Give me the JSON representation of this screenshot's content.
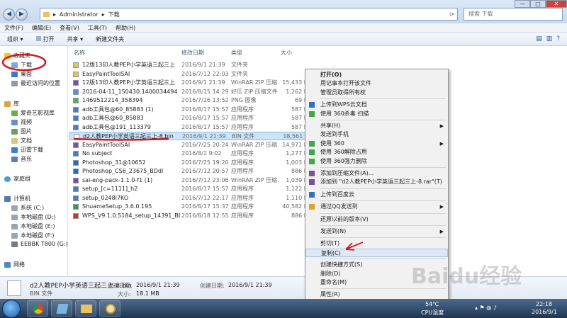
{
  "window": {
    "breadcrumb": [
      "Administrator",
      "下载"
    ],
    "search_placeholder": "搜索 下载",
    "controls": [
      "—",
      "□",
      "✕"
    ]
  },
  "menubar": [
    "文件(F)",
    "编辑(E)",
    "查看(V)",
    "工具(T)",
    "帮助(H)"
  ],
  "toolbar": {
    "organize": "组织 ▾",
    "open": "打开",
    "share": "共享 ▾",
    "new_folder": "新建文件夹"
  },
  "nav": {
    "favorites": "收藏夹",
    "downloads": "下载",
    "desktop": "桌面",
    "recent": "最近访问的位置",
    "library": "库",
    "lib_items": [
      "爱奇艺影视库",
      "视频",
      "图片",
      "文档",
      "迅雷下载",
      "音乐"
    ],
    "homegroup": "家庭组",
    "computer": "计算机",
    "drives": [
      "系统 (C:)",
      "本地磁盘 (D:)",
      "本地磁盘 (E:)",
      "本地磁盘 (F:)",
      "EEBBK T800 (G:)"
    ],
    "network": "网络"
  },
  "columns": {
    "name": "名称",
    "date": "修改日期",
    "type": "类型",
    "size": "大小"
  },
  "files": [
    {
      "name": "12版13印人教PEP小学英语三起三上",
      "date": "2016/9/1 21:39",
      "type": "文件夹",
      "size": "",
      "icon_color": "#e8c25a"
    },
    {
      "name": "EasyPaintToolSAI",
      "date": "2016/7/12 22:03",
      "type": "文件夹",
      "size": "",
      "icon_color": "#e8c25a"
    },
    {
      "name": "12版13印人教PEP小学英语三起三上",
      "date": "2016/9/1 21:39",
      "type": "WinRAR ZIP 压缩...",
      "size": "15,433 K",
      "icon_color": "#7a4fa0"
    },
    {
      "name": "2016-04-11_150430.1400034494",
      "date": "2016/8/15 14:29",
      "type": "好压 ZIP 压缩文件",
      "size": "1,262 K",
      "icon_color": "#5f8fc6"
    },
    {
      "name": "1469512214_358394",
      "date": "2016/7/26 13:52",
      "type": "PNG 图像",
      "size": "69 K",
      "icon_color": "#6ba35b"
    },
    {
      "name": "adb工具包@60_85883 (1)",
      "date": "2016/8/17 15:57",
      "type": "应用程序",
      "size": "587 K",
      "icon_color": "#4a7bc0"
    },
    {
      "name": "adb工具包@60_85883",
      "date": "2016/8/17 15:57",
      "type": "应用程序",
      "size": "587 K",
      "icon_color": "#4a7bc0"
    },
    {
      "name": "adb工具包@191_113379",
      "date": "2016/8/17 15:57",
      "type": "应用程序",
      "size": "587 K",
      "icon_color": "#4a7bc0"
    },
    {
      "name": "d2人教PEP小学英语三起三上-8.bin",
      "date": "2016/9/1 21:39",
      "type": "BIN 文件",
      "size": "18,561 K",
      "icon_color": "#ffffff",
      "selected": true
    },
    {
      "name": "EasyPaintToolSAI",
      "date": "2016/7/25 20:24",
      "type": "WinRAR ZIP 压缩...",
      "size": "14,971 K",
      "icon_color": "#7a4fa0"
    },
    {
      "name": "No subject",
      "date": "2016/8/2 9:02",
      "type": "应用程序",
      "size": "1,277 K",
      "icon_color": "#4a7bc0"
    },
    {
      "name": "Photoshop_31@10652",
      "date": "2016/7/25 19:20",
      "type": "应用程序",
      "size": "1,003 K",
      "icon_color": "#2b6cb5"
    },
    {
      "name": "Photoshop_CS6_23675_BDdl",
      "date": "2016/7/12 20:57",
      "type": "应用程序",
      "size": "886 K",
      "icon_color": "#2b6cb5"
    },
    {
      "name": "sai-eng-pack-1.1.0-f1 (1)",
      "date": "2016/7/12 23:06",
      "type": "WinRAR ZIP 压缩...",
      "size": "1,039 K",
      "icon_color": "#7a4fa0"
    },
    {
      "name": "setup_[c=1111]_h2",
      "date": "2016/8/17 15:57",
      "type": "应用程序",
      "size": "1,122 K",
      "icon_color": "#4a7bc0"
    },
    {
      "name": "setup_0248l7KO",
      "date": "2016/7/12 22:17",
      "type": "应用程序",
      "size": "1,110 K",
      "icon_color": "#4a7bc0"
    },
    {
      "name": "ShuameSetup_3.6.0.195",
      "date": "2016/8/17 15:37",
      "type": "应用程序",
      "size": "40,582 K",
      "icon_color": "#3c9b4a"
    },
    {
      "name": "WPS_V9.1.0.5184_setup_14391_BDdl",
      "date": "2016/8/18 12:55",
      "type": "应用程序",
      "size": "886 K",
      "icon_color": "#c0392b"
    }
  ],
  "context_menu": [
    {
      "label": "打开(O)",
      "bold": true
    },
    {
      "label": "用记事本打开该文件"
    },
    {
      "label": "管理员取得所有权"
    },
    {
      "sep": true
    },
    {
      "label": "上传到WPS云文档",
      "icon_color": "#2f6fc6"
    },
    {
      "label": "使用 360杀毒 扫描",
      "icon_color": "#3ea84a"
    },
    {
      "sep": true
    },
    {
      "label": "共享(H)",
      "submenu": true
    },
    {
      "label": "发送到手机"
    },
    {
      "label": "使用 360",
      "submenu": true,
      "icon_color": "#3ea84a"
    },
    {
      "label": "使用 360解除占用",
      "icon_color": "#3ea84a"
    },
    {
      "label": "使用 360强力删除",
      "icon_color": "#3ea84a"
    },
    {
      "sep": true
    },
    {
      "label": "添加到压缩文件(A)...",
      "icon_color": "#7a4fa0"
    },
    {
      "label": "添加到 \"d2人教PEP小学英语三起三上-8.rar\"(T)",
      "icon_color": "#7a4fa0"
    },
    {
      "sep": true
    },
    {
      "label": "上传到百度云",
      "icon_color": "#2f6fc6"
    },
    {
      "sep": true
    },
    {
      "label": "通过QQ发送到",
      "submenu": true,
      "icon_color": "#e2a322"
    },
    {
      "sep": true
    },
    {
      "label": "还原以前的版本(V)"
    },
    {
      "sep": true
    },
    {
      "label": "发送到(N)",
      "submenu": true
    },
    {
      "sep": true
    },
    {
      "label": "剪切(T)"
    },
    {
      "label": "复制(C)",
      "highlight": true
    },
    {
      "sep": true
    },
    {
      "label": "创建快捷方式(S)"
    },
    {
      "label": "删除(D)"
    },
    {
      "label": "重命名(M)"
    },
    {
      "sep": true
    },
    {
      "label": "属性(R)"
    }
  ],
  "details": {
    "name": "d2人教PEP小学英语三起三上-8.bin",
    "type": "BIN 文件",
    "modified_label": "修改日期:",
    "modified": "2016/9/1 21:39",
    "size_label": "大小:",
    "size": "18.1 MB",
    "created_label": "创建日期:",
    "created": "2016/9/1 21:39"
  },
  "taskbar": {
    "temp": "54℃",
    "temp_label": "CPU温度",
    "time": "22:18",
    "date": "2016/9/1"
  },
  "watermark": "Baidu经验",
  "colors": {
    "annotation_red": "#d4191c",
    "title_bar": "#c7d9ee",
    "selection": "#cce4f7"
  }
}
